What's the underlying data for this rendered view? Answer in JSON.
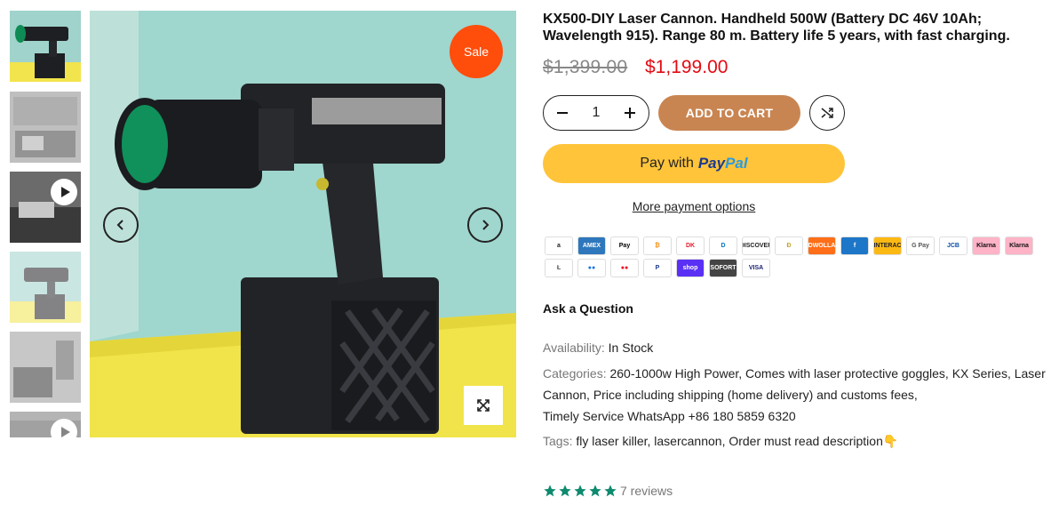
{
  "gallery": {
    "sale_badge": "Sale",
    "thumbnails": [
      {
        "kind": "image",
        "active": true
      },
      {
        "kind": "image",
        "active": false
      },
      {
        "kind": "video",
        "active": false
      },
      {
        "kind": "image",
        "active": false
      },
      {
        "kind": "image",
        "active": false
      },
      {
        "kind": "video",
        "active": false
      }
    ],
    "prev_icon": "chevron-left-icon",
    "next_icon": "chevron-right-icon",
    "zoom_icon": "expand-icon"
  },
  "product": {
    "title": "KX500-DIY Laser Cannon. Handheld 500W (Battery DC 46V 10Ah; Wavelength 915). Range 80 m. Battery life 5 years, with fast charging.",
    "price_old": "$1,399.00",
    "price_new": "$1,199.00",
    "quantity": "1",
    "add_to_cart": "ADD TO CART",
    "paypal_prefix": "Pay with",
    "paypal_brand_1": "Pay",
    "paypal_brand_2": "Pal",
    "more_payment": "More payment options",
    "ask_question": "Ask a Question"
  },
  "payment_methods": [
    {
      "name": "amazon",
      "label": "a",
      "bg": "#ffffff",
      "fg": "#222222"
    },
    {
      "name": "american-express",
      "label": "AMEX",
      "bg": "#2e77bc",
      "fg": "#ffffff"
    },
    {
      "name": "apple-pay",
      "label": "Pay",
      "bg": "#ffffff",
      "fg": "#000000"
    },
    {
      "name": "bitcoin",
      "label": "₿",
      "bg": "#ffffff",
      "fg": "#f7931a"
    },
    {
      "name": "dankort",
      "label": "DK",
      "bg": "#ffffff",
      "fg": "#e31e2e"
    },
    {
      "name": "diners-club",
      "label": "D",
      "bg": "#ffffff",
      "fg": "#0079be"
    },
    {
      "name": "discover",
      "label": "DISCOVER",
      "bg": "#ffffff",
      "fg": "#222222"
    },
    {
      "name": "dogecoin",
      "label": "Ð",
      "bg": "#ffffff",
      "fg": "#c2a633"
    },
    {
      "name": "dwolla",
      "label": "DWOLLA",
      "bg": "#ff6e18",
      "fg": "#ffffff"
    },
    {
      "name": "forbrugsforeningen",
      "label": "f",
      "bg": "#1d76c7",
      "fg": "#ffffff"
    },
    {
      "name": "interac",
      "label": "INTERAC",
      "bg": "#fdb913",
      "fg": "#222222"
    },
    {
      "name": "google-pay",
      "label": "G Pay",
      "bg": "#ffffff",
      "fg": "#555555"
    },
    {
      "name": "jcb",
      "label": "JCB",
      "bg": "#ffffff",
      "fg": "#0b4ea2"
    },
    {
      "name": "klarna-1",
      "label": "Klarna",
      "bg": "#ffb3c7",
      "fg": "#111111"
    },
    {
      "name": "klarna-2",
      "label": "Klarna",
      "bg": "#ffb3c7",
      "fg": "#111111"
    },
    {
      "name": "litecoin",
      "label": "Ł",
      "bg": "#ffffff",
      "fg": "#555555"
    },
    {
      "name": "maestro",
      "label": "●●",
      "bg": "#ffffff",
      "fg": "#1a73e8"
    },
    {
      "name": "mastercard",
      "label": "●●",
      "bg": "#ffffff",
      "fg": "#eb001b"
    },
    {
      "name": "paypal",
      "label": "P",
      "bg": "#ffffff",
      "fg": "#1a3a8f"
    },
    {
      "name": "shop-pay",
      "label": "shop",
      "bg": "#5a31f4",
      "fg": "#ffffff"
    },
    {
      "name": "sofort",
      "label": "SOFORT",
      "bg": "#444444",
      "fg": "#ffffff"
    },
    {
      "name": "visa",
      "label": "VISA",
      "bg": "#ffffff",
      "fg": "#1a1f71"
    }
  ],
  "details": {
    "availability_label": "Availability:",
    "availability_value": "In Stock",
    "categories_label": "Categories:",
    "categories": [
      "260-1000w High Power",
      "Comes with laser protective goggles",
      "KX Series",
      "Laser Cannon",
      "Price including shipping (home delivery) and customs fees",
      "Timely Service WhatsApp +86 180 5859 6320"
    ],
    "tags_label": "Tags:",
    "tags": [
      "fly laser killer",
      "lasercannon",
      "Order must read description👇"
    ]
  },
  "reviews": {
    "rating": 5,
    "text": "7 reviews",
    "star_color": "#0e8a6e"
  }
}
